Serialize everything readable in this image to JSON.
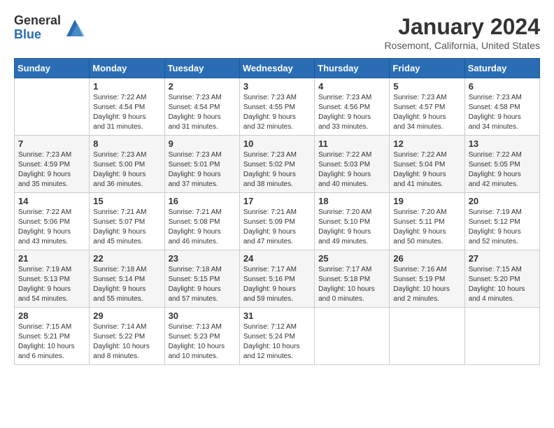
{
  "header": {
    "logo_general": "General",
    "logo_blue": "Blue",
    "month_year": "January 2024",
    "location": "Rosemont, California, United States"
  },
  "days_of_week": [
    "Sunday",
    "Monday",
    "Tuesday",
    "Wednesday",
    "Thursday",
    "Friday",
    "Saturday"
  ],
  "weeks": [
    [
      {
        "day": "",
        "info": ""
      },
      {
        "day": "1",
        "info": "Sunrise: 7:22 AM\nSunset: 4:54 PM\nDaylight: 9 hours\nand 31 minutes."
      },
      {
        "day": "2",
        "info": "Sunrise: 7:23 AM\nSunset: 4:54 PM\nDaylight: 9 hours\nand 31 minutes."
      },
      {
        "day": "3",
        "info": "Sunrise: 7:23 AM\nSunset: 4:55 PM\nDaylight: 9 hours\nand 32 minutes."
      },
      {
        "day": "4",
        "info": "Sunrise: 7:23 AM\nSunset: 4:56 PM\nDaylight: 9 hours\nand 33 minutes."
      },
      {
        "day": "5",
        "info": "Sunrise: 7:23 AM\nSunset: 4:57 PM\nDaylight: 9 hours\nand 34 minutes."
      },
      {
        "day": "6",
        "info": "Sunrise: 7:23 AM\nSunset: 4:58 PM\nDaylight: 9 hours\nand 34 minutes."
      }
    ],
    [
      {
        "day": "7",
        "info": "Sunrise: 7:23 AM\nSunset: 4:59 PM\nDaylight: 9 hours\nand 35 minutes."
      },
      {
        "day": "8",
        "info": "Sunrise: 7:23 AM\nSunset: 5:00 PM\nDaylight: 9 hours\nand 36 minutes."
      },
      {
        "day": "9",
        "info": "Sunrise: 7:23 AM\nSunset: 5:01 PM\nDaylight: 9 hours\nand 37 minutes."
      },
      {
        "day": "10",
        "info": "Sunrise: 7:23 AM\nSunset: 5:02 PM\nDaylight: 9 hours\nand 38 minutes."
      },
      {
        "day": "11",
        "info": "Sunrise: 7:22 AM\nSunset: 5:03 PM\nDaylight: 9 hours\nand 40 minutes."
      },
      {
        "day": "12",
        "info": "Sunrise: 7:22 AM\nSunset: 5:04 PM\nDaylight: 9 hours\nand 41 minutes."
      },
      {
        "day": "13",
        "info": "Sunrise: 7:22 AM\nSunset: 5:05 PM\nDaylight: 9 hours\nand 42 minutes."
      }
    ],
    [
      {
        "day": "14",
        "info": "Sunrise: 7:22 AM\nSunset: 5:06 PM\nDaylight: 9 hours\nand 43 minutes."
      },
      {
        "day": "15",
        "info": "Sunrise: 7:21 AM\nSunset: 5:07 PM\nDaylight: 9 hours\nand 45 minutes."
      },
      {
        "day": "16",
        "info": "Sunrise: 7:21 AM\nSunset: 5:08 PM\nDaylight: 9 hours\nand 46 minutes."
      },
      {
        "day": "17",
        "info": "Sunrise: 7:21 AM\nSunset: 5:09 PM\nDaylight: 9 hours\nand 47 minutes."
      },
      {
        "day": "18",
        "info": "Sunrise: 7:20 AM\nSunset: 5:10 PM\nDaylight: 9 hours\nand 49 minutes."
      },
      {
        "day": "19",
        "info": "Sunrise: 7:20 AM\nSunset: 5:11 PM\nDaylight: 9 hours\nand 50 minutes."
      },
      {
        "day": "20",
        "info": "Sunrise: 7:19 AM\nSunset: 5:12 PM\nDaylight: 9 hours\nand 52 minutes."
      }
    ],
    [
      {
        "day": "21",
        "info": "Sunrise: 7:19 AM\nSunset: 5:13 PM\nDaylight: 9 hours\nand 54 minutes."
      },
      {
        "day": "22",
        "info": "Sunrise: 7:18 AM\nSunset: 5:14 PM\nDaylight: 9 hours\nand 55 minutes."
      },
      {
        "day": "23",
        "info": "Sunrise: 7:18 AM\nSunset: 5:15 PM\nDaylight: 9 hours\nand 57 minutes."
      },
      {
        "day": "24",
        "info": "Sunrise: 7:17 AM\nSunset: 5:16 PM\nDaylight: 9 hours\nand 59 minutes."
      },
      {
        "day": "25",
        "info": "Sunrise: 7:17 AM\nSunset: 5:18 PM\nDaylight: 10 hours\nand 0 minutes."
      },
      {
        "day": "26",
        "info": "Sunrise: 7:16 AM\nSunset: 5:19 PM\nDaylight: 10 hours\nand 2 minutes."
      },
      {
        "day": "27",
        "info": "Sunrise: 7:15 AM\nSunset: 5:20 PM\nDaylight: 10 hours\nand 4 minutes."
      }
    ],
    [
      {
        "day": "28",
        "info": "Sunrise: 7:15 AM\nSunset: 5:21 PM\nDaylight: 10 hours\nand 6 minutes."
      },
      {
        "day": "29",
        "info": "Sunrise: 7:14 AM\nSunset: 5:22 PM\nDaylight: 10 hours\nand 8 minutes."
      },
      {
        "day": "30",
        "info": "Sunrise: 7:13 AM\nSunset: 5:23 PM\nDaylight: 10 hours\nand 10 minutes."
      },
      {
        "day": "31",
        "info": "Sunrise: 7:12 AM\nSunset: 5:24 PM\nDaylight: 10 hours\nand 12 minutes."
      },
      {
        "day": "",
        "info": ""
      },
      {
        "day": "",
        "info": ""
      },
      {
        "day": "",
        "info": ""
      }
    ]
  ]
}
